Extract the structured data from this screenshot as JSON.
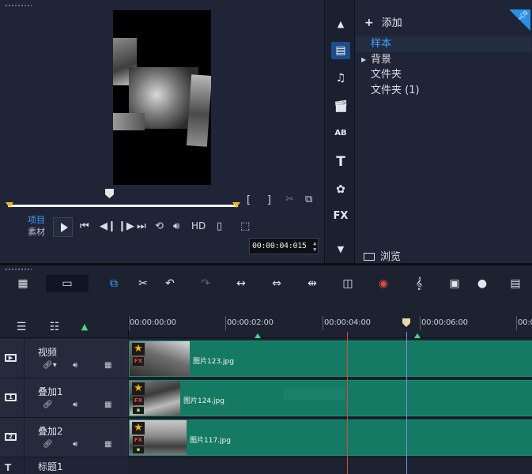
{
  "player": {
    "project_label": "项目",
    "clip_label": "素材",
    "timecode": "00:00:04:015",
    "hd_label": "HD",
    "mark_in": "[",
    "mark_out": "]"
  },
  "library": {
    "add_label": "添加",
    "items": [
      {
        "label": "样本",
        "selected": true
      },
      {
        "label": "背景",
        "selected": false,
        "expandable": true
      },
      {
        "label": "文件夹",
        "selected": false
      },
      {
        "label": "文件夹 (1)",
        "selected": false
      }
    ],
    "browse_label": "浏览",
    "side_text": {
      "title_icon": "T",
      "text_icon": "AB",
      "fx_icon": "FX"
    }
  },
  "ruler": {
    "labels": [
      "00:00:00:00",
      "00:00:02:00",
      "00:00:04:00",
      "00:00:06:00",
      "00:0"
    ]
  },
  "tracks": [
    {
      "name": "视频",
      "clip": "图片123.jpg"
    },
    {
      "name": "叠加1",
      "clip": "图片124.jpg"
    },
    {
      "name": "叠加2",
      "clip": "图片117.jpg"
    },
    {
      "name": "标题1"
    }
  ],
  "colors": {
    "clip_green": "#157a63",
    "accent_blue": "#3ea2ff",
    "marker_yellow": "#f2b62c",
    "playhead_red": "#d44b3e"
  }
}
